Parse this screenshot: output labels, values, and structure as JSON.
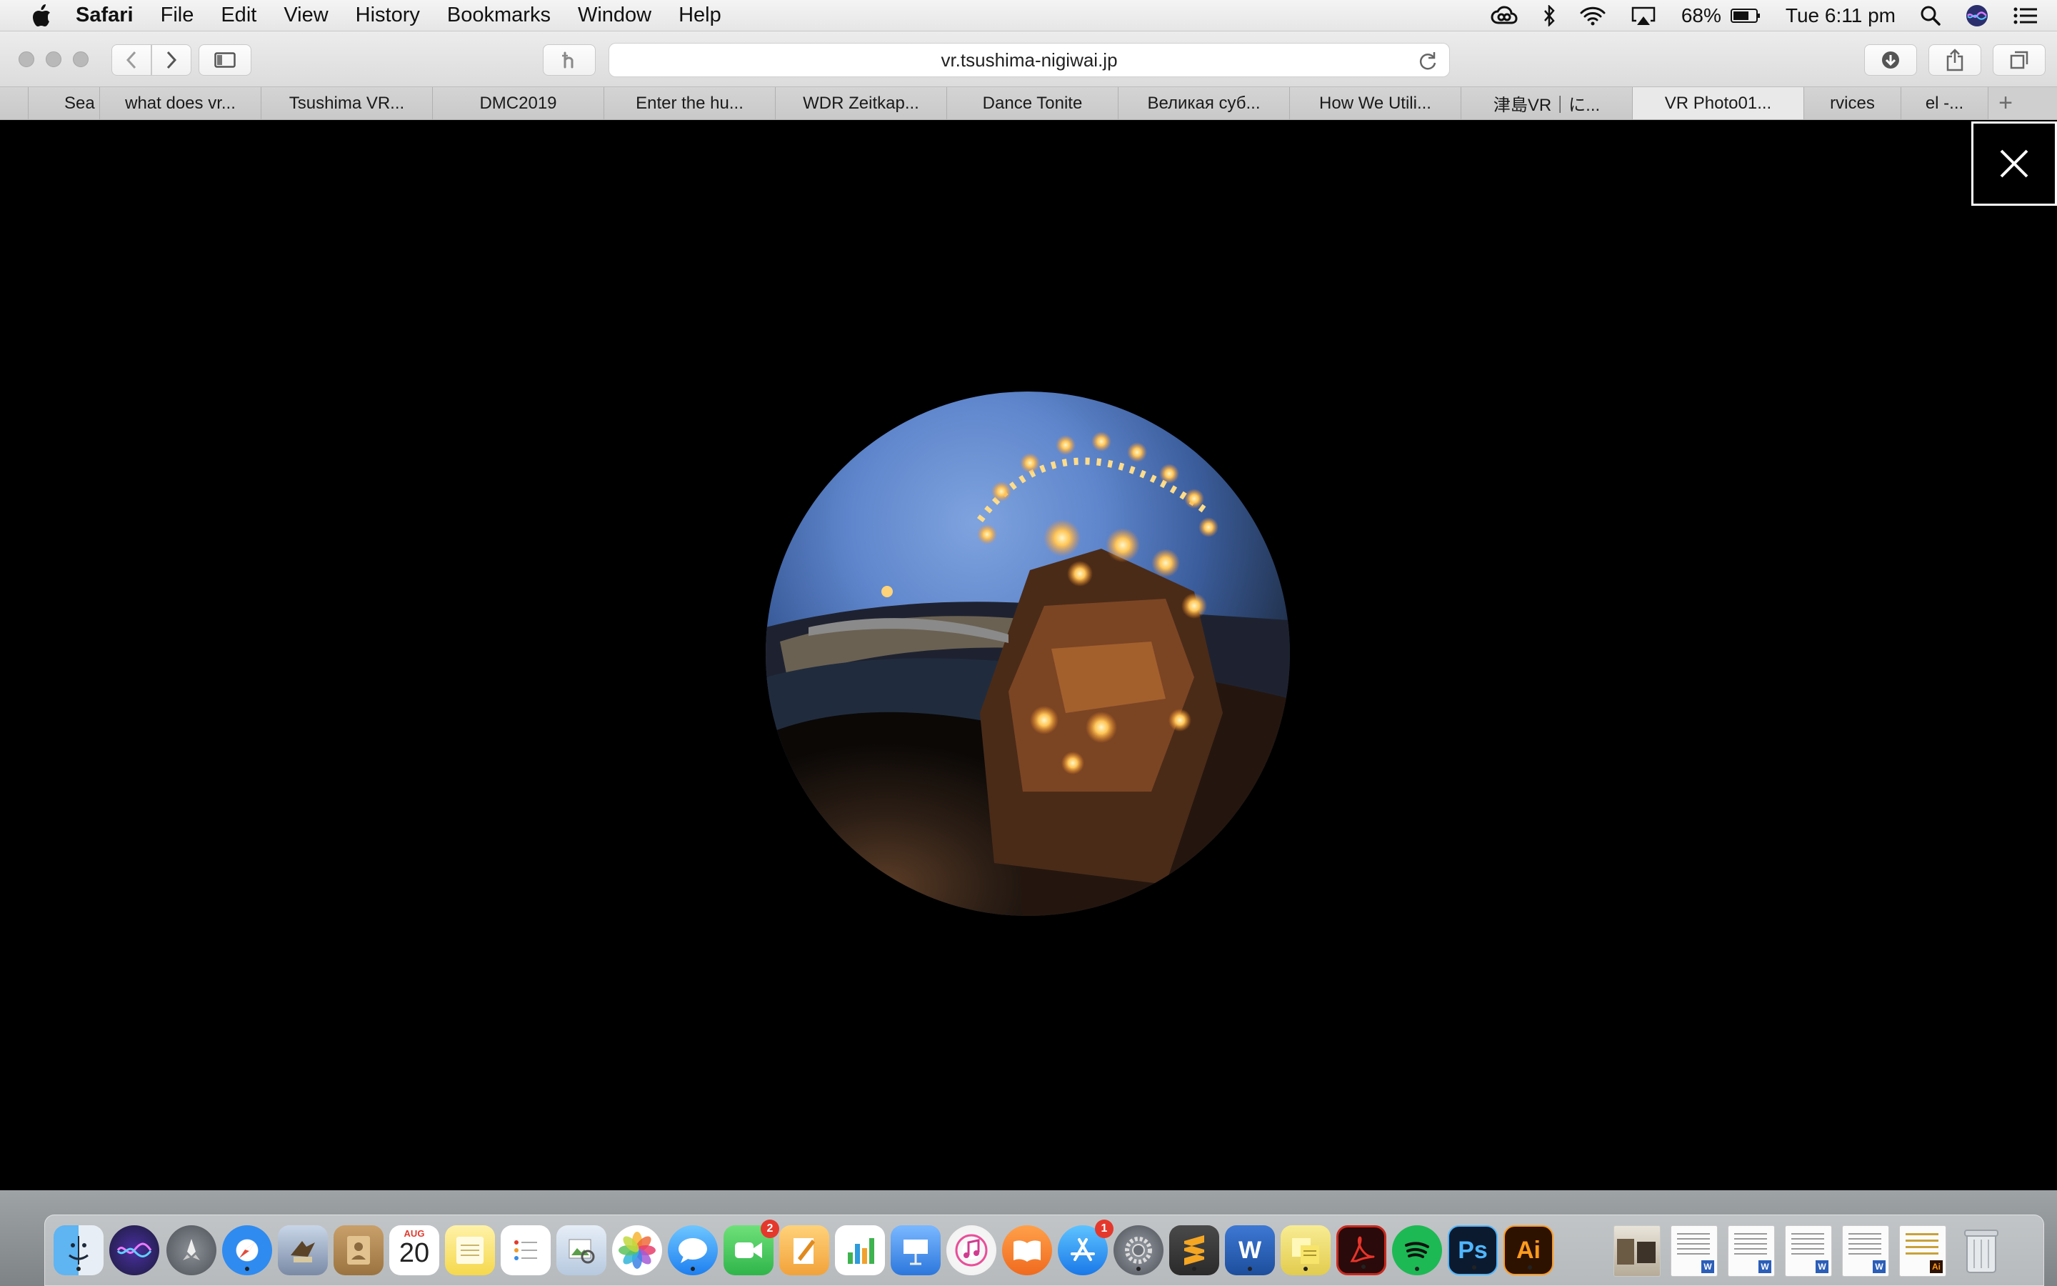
{
  "menubar": {
    "app_name": "Safari",
    "items": [
      "File",
      "Edit",
      "View",
      "History",
      "Bookmarks",
      "Window",
      "Help"
    ],
    "battery": "68%",
    "clock": "Tue 6:11 pm"
  },
  "toolbar": {
    "url": "vr.tsushima-nigiwai.jp"
  },
  "tabs": [
    "Sea",
    "what does vr...",
    "Tsushima VR...",
    "DMC2019",
    "Enter the hu...",
    "WDR Zeitkap...",
    "Dance Tonite",
    "Великая суб...",
    "How We Utili...",
    "津島VR｜に...",
    "VR Photo01...",
    "rvices",
    "el -..."
  ],
  "active_tab_index": 10,
  "dock": {
    "calendar_month": "AUG",
    "calendar_day": "20",
    "facetime_badge": "2",
    "appstore_badge": "1",
    "photoshop_label": "Ps",
    "illustrator_label": "Ai",
    "word_label": "W"
  },
  "colors": {
    "content_bg": "#000000",
    "menubar_bg": "#eeeeee",
    "badge": "#e5382c"
  }
}
